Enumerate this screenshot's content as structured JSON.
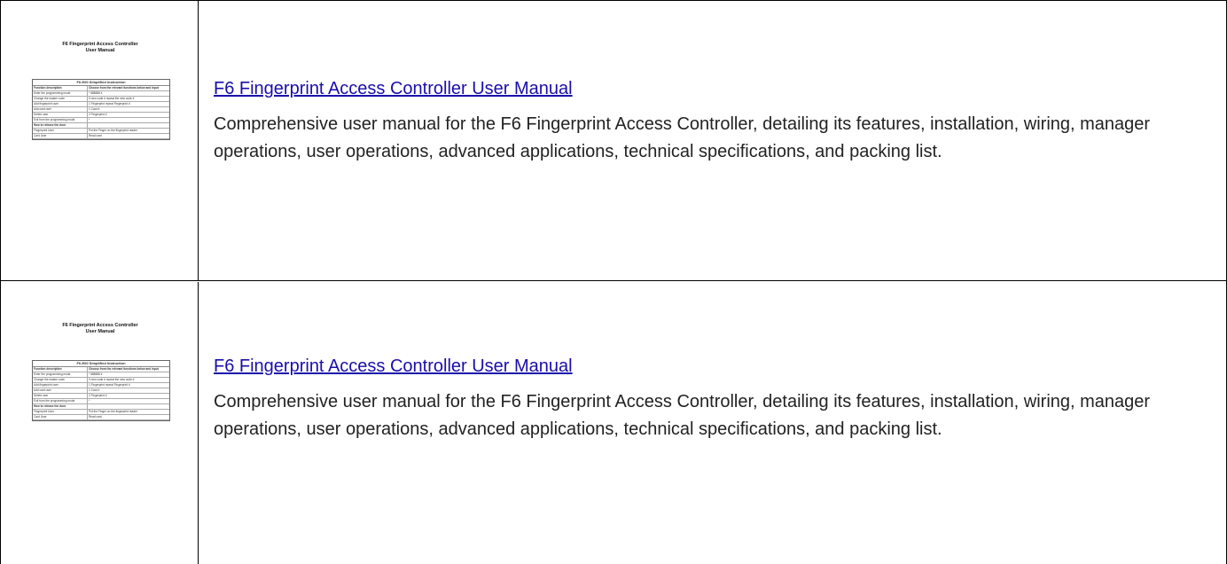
{
  "results": [
    {
      "thumbnail": {
        "title_line1": "F6 Fingerprint Access Controller",
        "title_line2": "User Manual",
        "table_header": "F6-E00 Simplified Instruction",
        "col1": "Function description",
        "col2": "Choose from the relevant functions below and input",
        "rows": [
          [
            "Enter the programming mode",
            "* 888888 #"
          ],
          [
            "Change the master code",
            "0 new code # repeat the new code #"
          ],
          [
            "Add fingerprint user",
            "1 Fingerprint repeat Fingerprint #"
          ],
          [
            "Add card user",
            "1 Card #"
          ],
          [
            "Delete user",
            "2 Fingerprint #"
          ],
          [
            "Exit from the programming mode",
            "*"
          ],
          [
            "How to release the door",
            ""
          ],
          [
            "Fingerprint User",
            "Put the Finger on the fingerprint reader"
          ],
          [
            "Card User",
            "Read card"
          ]
        ]
      },
      "title": "F6 Fingerprint Access Controller User Manual",
      "description": "Comprehensive user manual for the F6 Fingerprint Access Controller, detailing its features, installation, wiring, manager operations, user operations, advanced applications, technical specifications, and packing list."
    },
    {
      "thumbnail": {
        "title_line1": "F6 Fingerprint Access Controller",
        "title_line2": "User Manual",
        "table_header": "F6-E00 Simplified Instruction",
        "col1": "Function description",
        "col2": "Choose from the relevant functions below and input",
        "rows": [
          [
            "Enter the programming mode",
            "* 888888 #"
          ],
          [
            "Change the master code",
            "0 new code # repeat the new code #"
          ],
          [
            "Add fingerprint user",
            "1 Fingerprint repeat Fingerprint #"
          ],
          [
            "Add card user",
            "1 Card #"
          ],
          [
            "Delete user",
            "2 Fingerprint #"
          ],
          [
            "Exit from the programming mode",
            "*"
          ],
          [
            "How to release the door",
            ""
          ],
          [
            "Fingerprint User",
            "Put the Finger on the fingerprint reader"
          ],
          [
            "Card User",
            "Read card"
          ]
        ]
      },
      "title": "F6 Fingerprint Access Controller User Manual",
      "description": "Comprehensive user manual for the F6 Fingerprint Access Controller, detailing its features, installation, wiring, manager operations, user operations, advanced applications, technical specifications, and packing list."
    }
  ]
}
